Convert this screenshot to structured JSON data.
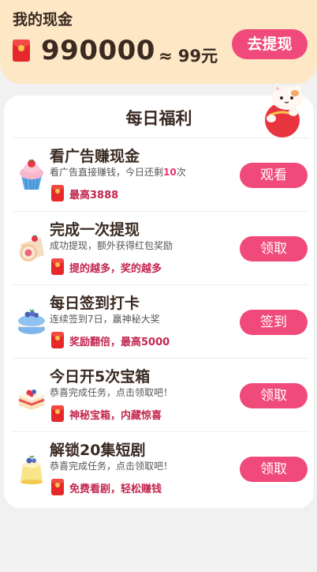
{
  "header": {
    "title": "我的现金",
    "amount": "990000",
    "approx": "≈ 99元",
    "withdraw_label": "去提现"
  },
  "welfare": {
    "title": "每日福利",
    "tasks": [
      {
        "title": "看广告赚现金",
        "desc_prefix": "看广告直接赚钱，今日还剩",
        "desc_highlight": "10",
        "desc_suffix": "次",
        "reward": "最高3888",
        "button": "观看",
        "icon": "strawberry-cupcake-icon"
      },
      {
        "title": "完成一次提现",
        "desc_prefix": "成功提现，额外获得红包奖励",
        "desc_highlight": "",
        "desc_suffix": "",
        "reward": "提的越多，奖的越多",
        "button": "领取",
        "icon": "swiss-roll-cake-icon"
      },
      {
        "title": "每日签到打卡",
        "desc_prefix": "连续签到7日，赢神秘大奖",
        "desc_highlight": "",
        "desc_suffix": "",
        "reward": "奖励翻倍，最高5000",
        "button": "签到",
        "icon": "blue-macaron-icon"
      },
      {
        "title": "今日开5次宝箱",
        "desc_prefix": "恭喜完成任务，点击领取吧！",
        "desc_highlight": "",
        "desc_suffix": "",
        "reward": "神秘宝箱，内藏惊喜",
        "button": "领取",
        "icon": "layer-cake-icon"
      },
      {
        "title": "解锁20集短剧",
        "desc_prefix": "恭喜完成任务，点击领取吧！",
        "desc_highlight": "",
        "desc_suffix": "",
        "reward": "免费看剧，轻松赚钱",
        "button": "领取",
        "icon": "pudding-icon"
      }
    ]
  },
  "colors": {
    "header_bg": "#fde7c4",
    "accent": "#f04a7a",
    "envelope_red": "#e6282d",
    "highlight_text": "#e9346d",
    "reward_text": "#c2264d"
  }
}
